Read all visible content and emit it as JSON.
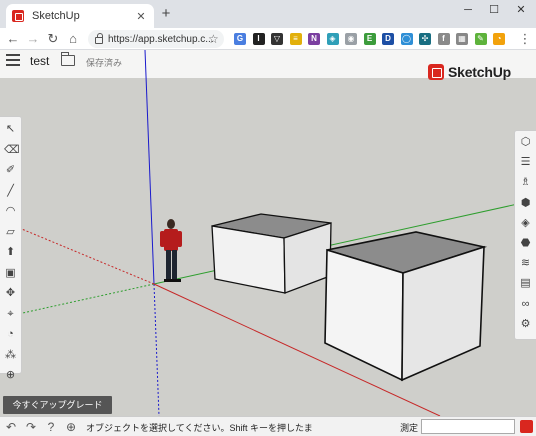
{
  "browser": {
    "tab_title": "SketchUp",
    "tab_close": "✕",
    "new_tab": "+",
    "window_minimize": "─",
    "window_maximize": "☐",
    "window_close": "✕",
    "url": "https://app.sketchup.c...",
    "back": "←",
    "forward": "→",
    "reload": "↻",
    "home": "⌂",
    "star": "☆",
    "menu": "⋮"
  },
  "extensions": [
    {
      "name": "translate-ext-icon",
      "color": "#4a7ee0",
      "glyph": "G"
    },
    {
      "name": "instapaper-ext-icon",
      "color": "#222222",
      "glyph": "I"
    },
    {
      "name": "pocket-ext-icon",
      "color": "#333333",
      "glyph": "▽"
    },
    {
      "name": "keep-ext-icon",
      "color": "#e2b00c",
      "glyph": "≡"
    },
    {
      "name": "onenote-ext-icon",
      "color": "#7b3fa0",
      "glyph": "N"
    },
    {
      "name": "shield-ext-icon",
      "color": "#2f9fb8",
      "glyph": "◈"
    },
    {
      "name": "camera-ext-icon",
      "color": "#9aa0a6",
      "glyph": "◉"
    },
    {
      "name": "evernote-ext-icon",
      "color": "#3c9c3c",
      "glyph": "E"
    },
    {
      "name": "disconnect-ext-icon",
      "color": "#1d4fa5",
      "glyph": "D"
    },
    {
      "name": "vpn-ext-icon",
      "color": "#2f8fd6",
      "glyph": "◯"
    },
    {
      "name": "clover-ext-icon",
      "color": "#196e82",
      "glyph": "✣"
    },
    {
      "name": "facebook-ext-icon",
      "color": "#8a8a8a",
      "glyph": "f"
    },
    {
      "name": "grid-ext-icon",
      "color": "#888888",
      "glyph": "▦"
    },
    {
      "name": "evernote-web-ext-icon",
      "color": "#5eb33c",
      "glyph": "✎"
    },
    {
      "name": "profile-avatar-icon",
      "color": "#f2a20c",
      "glyph": "◔"
    }
  ],
  "app": {
    "doc_title": "test",
    "saved_label": "保存済み",
    "logo_text": "SketchUp",
    "upgrade_label": "今すぐアップグレード",
    "status_text": "オブジェクトを選択してください。Shift キーを押したま",
    "measure_label": "測定",
    "measure_value": ""
  },
  "left_tools": [
    {
      "name": "select-tool-icon",
      "glyph": "↖"
    },
    {
      "name": "eraser-tool-icon",
      "glyph": "⌫"
    },
    {
      "name": "paint-bucket-tool-icon",
      "glyph": "✐"
    },
    {
      "name": "line-tool-icon",
      "glyph": "╱"
    },
    {
      "name": "arc-tool-icon",
      "glyph": "◠"
    },
    {
      "name": "rectangle-tool-icon",
      "glyph": "▱"
    },
    {
      "name": "push-pull-tool-icon",
      "glyph": "⬆"
    },
    {
      "name": "offset-tool-icon",
      "glyph": "▣"
    },
    {
      "name": "move-tool-icon",
      "glyph": "✥"
    },
    {
      "name": "tape-measure-tool-icon",
      "glyph": "⌖"
    },
    {
      "name": "text-tool-icon",
      "glyph": "◔"
    },
    {
      "name": "walk-tool-icon",
      "glyph": "⁂"
    },
    {
      "name": "section-plane-tool-icon",
      "glyph": "⊕"
    }
  ],
  "right_tools": [
    {
      "name": "entity-info-icon",
      "glyph": "⬡"
    },
    {
      "name": "outliner-icon",
      "glyph": "☰"
    },
    {
      "name": "instructor-icon",
      "glyph": "♗"
    },
    {
      "name": "components-icon",
      "glyph": "⬢"
    },
    {
      "name": "materials-icon",
      "glyph": "◈"
    },
    {
      "name": "styles-icon",
      "glyph": "⬣"
    },
    {
      "name": "layers-icon",
      "glyph": "≋"
    },
    {
      "name": "scenes-icon",
      "glyph": "▤"
    },
    {
      "name": "display-icon",
      "glyph": "∞"
    },
    {
      "name": "extension-warehouse-icon",
      "glyph": "⚙"
    }
  ],
  "status_icons": [
    {
      "name": "undo-icon",
      "glyph": "↶"
    },
    {
      "name": "redo-icon",
      "glyph": "↷"
    },
    {
      "name": "help-icon",
      "glyph": "?"
    },
    {
      "name": "globe-icon",
      "glyph": "⊕"
    }
  ],
  "colors": {
    "brand_red": "#d9271f",
    "axis_red": "#c62828",
    "axis_green": "#2e9e2e",
    "axis_blue": "#1a1acc",
    "box_face_front": "#f4f4f4",
    "box_face_side": "#e6e6e6",
    "box_face_top": "#8c8c8c"
  }
}
